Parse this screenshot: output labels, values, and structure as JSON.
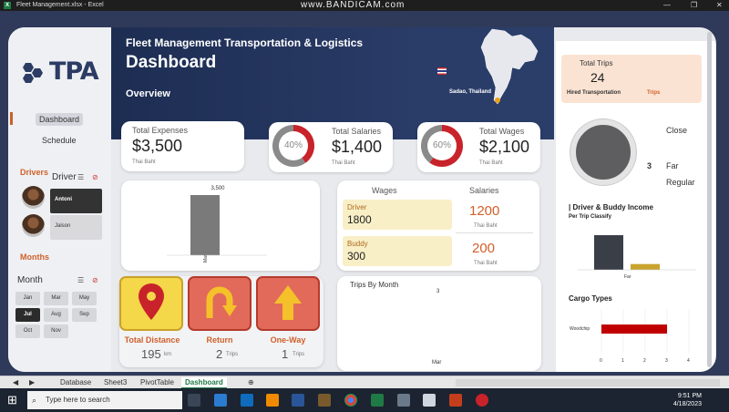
{
  "window": {
    "title": "Fleet Management.xlsx - Excel",
    "recorder": "www.BANDICAM.com"
  },
  "logo": {
    "text": "TPA"
  },
  "nav": {
    "dashboard": "Dashboard",
    "schedule": "Schedule"
  },
  "drivers": {
    "title": "Drivers",
    "filter_label": "Driver",
    "items": [
      "Antoni",
      "Jaison"
    ]
  },
  "months": {
    "title": "Months",
    "filter_label": "Month",
    "items": [
      "Jan",
      "Mar",
      "May",
      "Jul",
      "Aug",
      "Sep",
      "Oct",
      "Nov"
    ],
    "selected": "Jul"
  },
  "hero": {
    "title": "Fleet Management Transportation & Logistics",
    "subtitle": "Dashboard",
    "section": "Overview",
    "location": "Sadao, Thailand"
  },
  "kpi": {
    "expenses": {
      "label": "Total Expenses",
      "value": "$3,500",
      "unit": "Thai Baht"
    },
    "salaries": {
      "label": "Total Salaries",
      "value": "$1,400",
      "unit": "Thai Baht",
      "percent": "40%",
      "percent_value": 40
    },
    "wages": {
      "label": "Total Wages",
      "value": "$2,100",
      "unit": "Thai Baht",
      "percent": "60%",
      "percent_value": 60
    }
  },
  "bar_card": {
    "value_label": "3,500",
    "category": "Mar"
  },
  "wages_table": {
    "wages_header": "Wages",
    "salaries_header": "Salaries",
    "driver_label": "Driver",
    "driver_value": "1800",
    "driver_salary": "1200",
    "driver_unit": "Thai Baht",
    "buddy_label": "Buddy",
    "buddy_value": "300",
    "buddy_salary": "200",
    "buddy_unit": "Thai Baht"
  },
  "metrics": {
    "distance": {
      "label": "Total Distance",
      "value": "195",
      "unit": "km"
    },
    "return": {
      "label": "Return",
      "value": "2",
      "unit": "Trips"
    },
    "oneway": {
      "label": "One-Way",
      "value": "1",
      "unit": "Trips"
    }
  },
  "trips_month": {
    "title": "Trips By Month",
    "value_label": "3",
    "category": "Mar"
  },
  "total_trips": {
    "label": "Total Trips",
    "value": "24",
    "sub": "Hired Transportation",
    "tag": "Trips"
  },
  "trip_pie": {
    "value_label": "3",
    "legend": [
      "Close",
      "Far",
      "Regular"
    ]
  },
  "income": {
    "title": "| Driver & Buddy Income",
    "subtitle": "Per Trip Classify",
    "category": "Far"
  },
  "cargo": {
    "title": "Cargo Types",
    "category": "Woodchip",
    "ticks": [
      "0",
      "1",
      "2",
      "3",
      "4"
    ]
  },
  "sheets": {
    "tabs": [
      "Database",
      "Sheet3",
      "PivotTable",
      "Dashboard"
    ],
    "active": "Dashboard"
  },
  "taskbar": {
    "search_placeholder": "Type here to search",
    "time": "9:51 PM",
    "date": "4/18/2023"
  },
  "chart_data": [
    {
      "type": "bar",
      "categories": [
        "Mar"
      ],
      "values": [
        3500
      ]
    },
    {
      "type": "bar",
      "title": "Trips By Month",
      "categories": [
        "Mar"
      ],
      "values": [
        3
      ]
    },
    {
      "type": "pie",
      "categories": [
        "Close",
        "Far",
        "Regular"
      ],
      "values": [
        0,
        3,
        0
      ]
    },
    {
      "type": "bar",
      "title": "| Driver & Buddy Income",
      "subtitle": "Per Trip Classify",
      "categories": [
        "Far"
      ],
      "series": [
        {
          "values": [
            1200
          ]
        },
        {
          "values": [
            200
          ]
        }
      ],
      "colors": [
        "#3a3f47",
        "#c9a32e"
      ]
    },
    {
      "type": "bar",
      "title": "Cargo Types",
      "categories": [
        "Woodchip"
      ],
      "values": [
        3
      ],
      "xlim": [
        0,
        4
      ]
    }
  ]
}
